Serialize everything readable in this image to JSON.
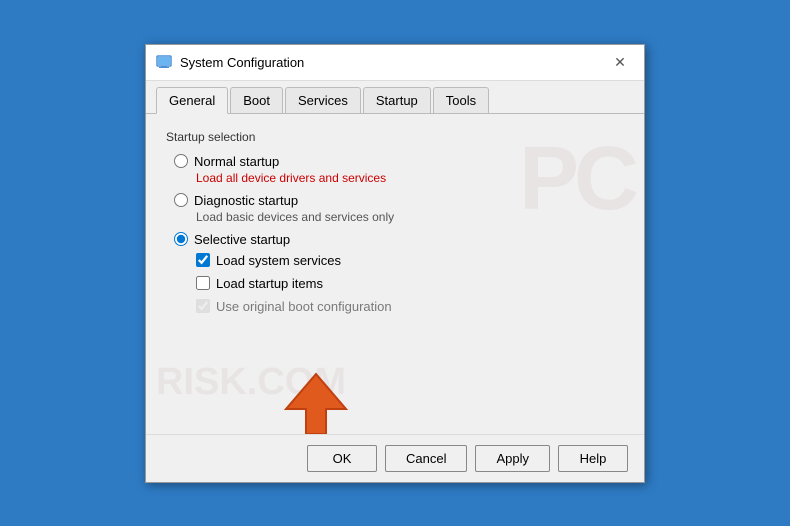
{
  "titleBar": {
    "title": "System Configuration",
    "iconAlt": "system-config-icon",
    "closeLabel": "✕"
  },
  "tabs": [
    {
      "label": "General",
      "active": true
    },
    {
      "label": "Boot",
      "active": false
    },
    {
      "label": "Services",
      "active": false
    },
    {
      "label": "Startup",
      "active": false
    },
    {
      "label": "Tools",
      "active": false
    }
  ],
  "content": {
    "sectionLabel": "Startup selection",
    "options": [
      {
        "label": "Normal startup",
        "subtext": "Load all device drivers and services",
        "subtextColor": "red",
        "type": "radio",
        "name": "startup",
        "value": "normal",
        "checked": false
      },
      {
        "label": "Diagnostic startup",
        "subtext": "Load basic devices and services only",
        "subtextColor": "gray",
        "type": "radio",
        "name": "startup",
        "value": "diagnostic",
        "checked": false
      },
      {
        "label": "Selective startup",
        "type": "radio",
        "name": "startup",
        "value": "selective",
        "checked": true
      }
    ],
    "checkboxes": [
      {
        "label": "Load system services",
        "checked": true,
        "disabled": false
      },
      {
        "label": "Load startup items",
        "checked": false,
        "disabled": false
      },
      {
        "label": "Use original boot configuration",
        "checked": true,
        "disabled": true
      }
    ]
  },
  "footer": {
    "ok": "OK",
    "cancel": "Cancel",
    "apply": "Apply",
    "help": "Help"
  },
  "watermark": {
    "top": "PC",
    "bottom": "RISK.COM"
  }
}
